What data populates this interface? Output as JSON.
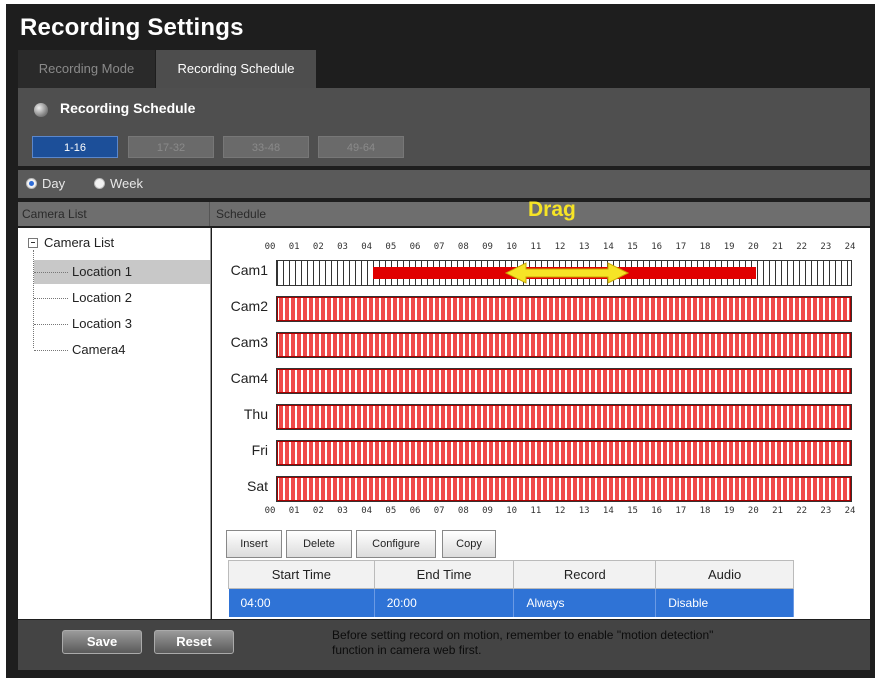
{
  "window": {
    "title": "Recording Settings"
  },
  "tabs": [
    {
      "label": "Recording Mode",
      "active": false
    },
    {
      "label": "Recording Schedule",
      "active": true
    }
  ],
  "section": {
    "title": "Recording Schedule",
    "ranges": [
      {
        "label": "1-16",
        "active": true
      },
      {
        "label": "17-32",
        "active": false
      },
      {
        "label": "33-48",
        "active": false
      },
      {
        "label": "49-64",
        "active": false
      }
    ]
  },
  "view_mode": {
    "options": [
      "Day",
      "Week"
    ],
    "selected": "Day"
  },
  "headers": {
    "camera_list": "Camera List",
    "schedule": "Schedule"
  },
  "annotation": {
    "drag": "Drag"
  },
  "camera_tree": {
    "root": "Camera List",
    "items": [
      "Location 1",
      "Location 2",
      "Location 3",
      "Camera4"
    ],
    "selected": "Location 1"
  },
  "schedule": {
    "hours": [
      "00",
      "01",
      "02",
      "03",
      "04",
      "05",
      "06",
      "07",
      "08",
      "09",
      "10",
      "11",
      "12",
      "13",
      "14",
      "15",
      "16",
      "17",
      "18",
      "19",
      "20",
      "21",
      "22",
      "23",
      "24"
    ],
    "rows": [
      {
        "label": "Cam1",
        "record_start": 4,
        "record_end": 20
      },
      {
        "label": "Cam2",
        "record_start": 0,
        "record_end": 24
      },
      {
        "label": "Cam3",
        "record_start": 0,
        "record_end": 24
      },
      {
        "label": "Cam4",
        "record_start": 0,
        "record_end": 24
      },
      {
        "label": "Thu",
        "record_start": 0,
        "record_end": 24
      },
      {
        "label": "Fri",
        "record_start": 0,
        "record_end": 24
      },
      {
        "label": "Sat",
        "record_start": 0,
        "record_end": 24
      }
    ]
  },
  "actions": {
    "insert": "Insert",
    "delete": "Delete",
    "configure": "Configure",
    "copy": "Copy"
  },
  "table": {
    "columns": [
      "Start Time",
      "End Time",
      "Record",
      "Audio"
    ],
    "rows": [
      {
        "start": "04:00",
        "end": "20:00",
        "record": "Always",
        "audio": "Disable"
      }
    ]
  },
  "footer": {
    "save": "Save",
    "reset": "Reset",
    "note_line1": "Before setting record on motion, remember to enable \"motion detection\"",
    "note_line2": "function in camera web first."
  },
  "colors": {
    "record_red": "#f04a4a",
    "active_blue": "#1c4f99",
    "drag_yellow": "#f6e426"
  }
}
